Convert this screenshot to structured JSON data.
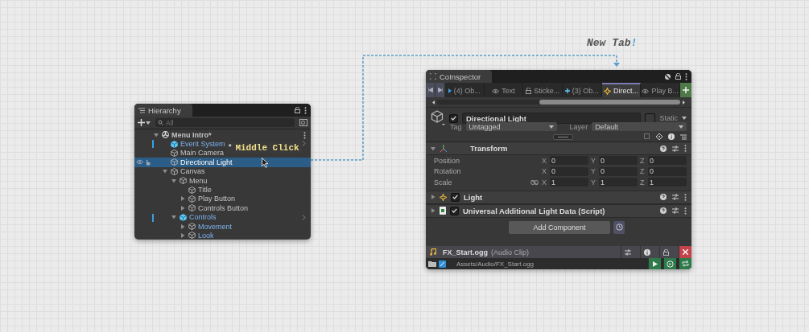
{
  "annotation": {
    "text": "New Tab",
    "mark": "!"
  },
  "hierarchy": {
    "title": "Hierarchy",
    "search": {
      "placeholder": "All"
    },
    "tree": [
      {
        "label": "Menu Intro*",
        "kind": "scene",
        "expanded": true,
        "selected": false,
        "children": [
          {
            "label": "Event System",
            "kind": "prefab-root",
            "selected": false
          },
          {
            "label": "Main Camera",
            "kind": "object",
            "selected": false
          },
          {
            "label": "Directional Light",
            "kind": "object",
            "selected": true
          },
          {
            "label": "Canvas",
            "kind": "object",
            "expanded": true,
            "selected": false,
            "children": [
              {
                "label": "Menu",
                "kind": "object",
                "expanded": true,
                "selected": false,
                "children": [
                  {
                    "label": "Title",
                    "kind": "object",
                    "selected": false
                  },
                  {
                    "label": "Play Button",
                    "kind": "object",
                    "expanded": false,
                    "selected": false
                  },
                  {
                    "label": "Controls Button",
                    "kind": "object",
                    "expanded": false,
                    "selected": false
                  }
                ]
              },
              {
                "label": "Controls",
                "kind": "prefab-root",
                "expanded": true,
                "selected": false,
                "children": [
                  {
                    "label": "Movement",
                    "kind": "prefab-child",
                    "expanded": false,
                    "selected": false
                  },
                  {
                    "label": "Look",
                    "kind": "prefab-child",
                    "expanded": false,
                    "selected": false
                  }
                ]
              }
            ]
          }
        ]
      }
    ]
  },
  "hint": {
    "mark": "*",
    "text": "Middle Click"
  },
  "inspector": {
    "title": "CoInspector",
    "tabs": [
      {
        "label": "(4) Ob...",
        "selected": false
      },
      {
        "label": "Text",
        "selected": false
      },
      {
        "label": "Sticke...",
        "selected": false
      },
      {
        "label": "(3) Ob...",
        "selected": false
      },
      {
        "label": "Direct...",
        "selected": true
      },
      {
        "label": "Play B...",
        "selected": false
      }
    ],
    "object": {
      "active": true,
      "name": "Directional Light",
      "static": false,
      "static_label": "Static",
      "tag_label": "Tag",
      "tag": "Untagged",
      "layer_label": "Layer",
      "layer": "Default"
    },
    "transform": {
      "title": "Transform",
      "expanded": true,
      "rows": [
        {
          "label": "Position",
          "link": false,
          "values": [
            {
              "axis": "X",
              "value": "0"
            },
            {
              "axis": "Y",
              "value": "0"
            },
            {
              "axis": "Z",
              "value": "0"
            }
          ]
        },
        {
          "label": "Rotation",
          "link": false,
          "values": [
            {
              "axis": "X",
              "value": "0"
            },
            {
              "axis": "Y",
              "value": "0"
            },
            {
              "axis": "Z",
              "value": "0"
            }
          ]
        },
        {
          "label": "Scale",
          "link": true,
          "values": [
            {
              "axis": "X",
              "value": "1"
            },
            {
              "axis": "Y",
              "value": "1"
            },
            {
              "axis": "Z",
              "value": "1"
            }
          ]
        }
      ]
    },
    "components": [
      {
        "title": "Light",
        "expanded": false,
        "enabled": true
      },
      {
        "title": "Universal Additional Light Data (Script)",
        "expanded": false,
        "enabled": true
      }
    ],
    "add_button": "Add Component",
    "asset": {
      "name": "FX_Start.ogg",
      "type": "(Audio Clip)",
      "path": "Assets/Audio/FX_Start.ogg"
    }
  }
}
